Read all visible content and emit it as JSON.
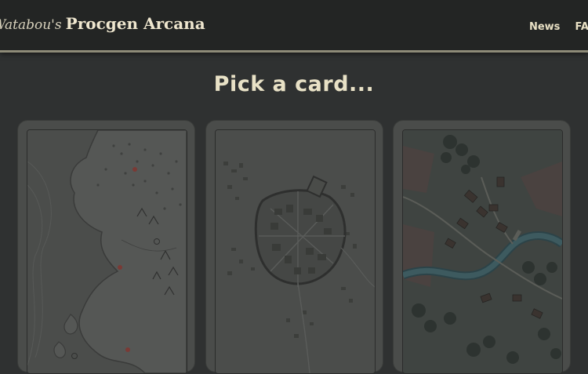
{
  "header": {
    "brand_owner": "Watabou's",
    "brand_name": "Procgen Arcana",
    "nav": [
      {
        "label": "News"
      },
      {
        "label": "FAQ"
      }
    ]
  },
  "main": {
    "heading": "Pick a card...",
    "cards": [
      {
        "name": "map-card-region",
        "icon": "coastal-map"
      },
      {
        "name": "map-card-city",
        "icon": "city-map"
      },
      {
        "name": "map-card-village",
        "icon": "village-map"
      }
    ]
  },
  "colors": {
    "background": "#2f3131",
    "header": "#232524",
    "accent": "#8e8b78",
    "text": "#e8e1c6"
  }
}
